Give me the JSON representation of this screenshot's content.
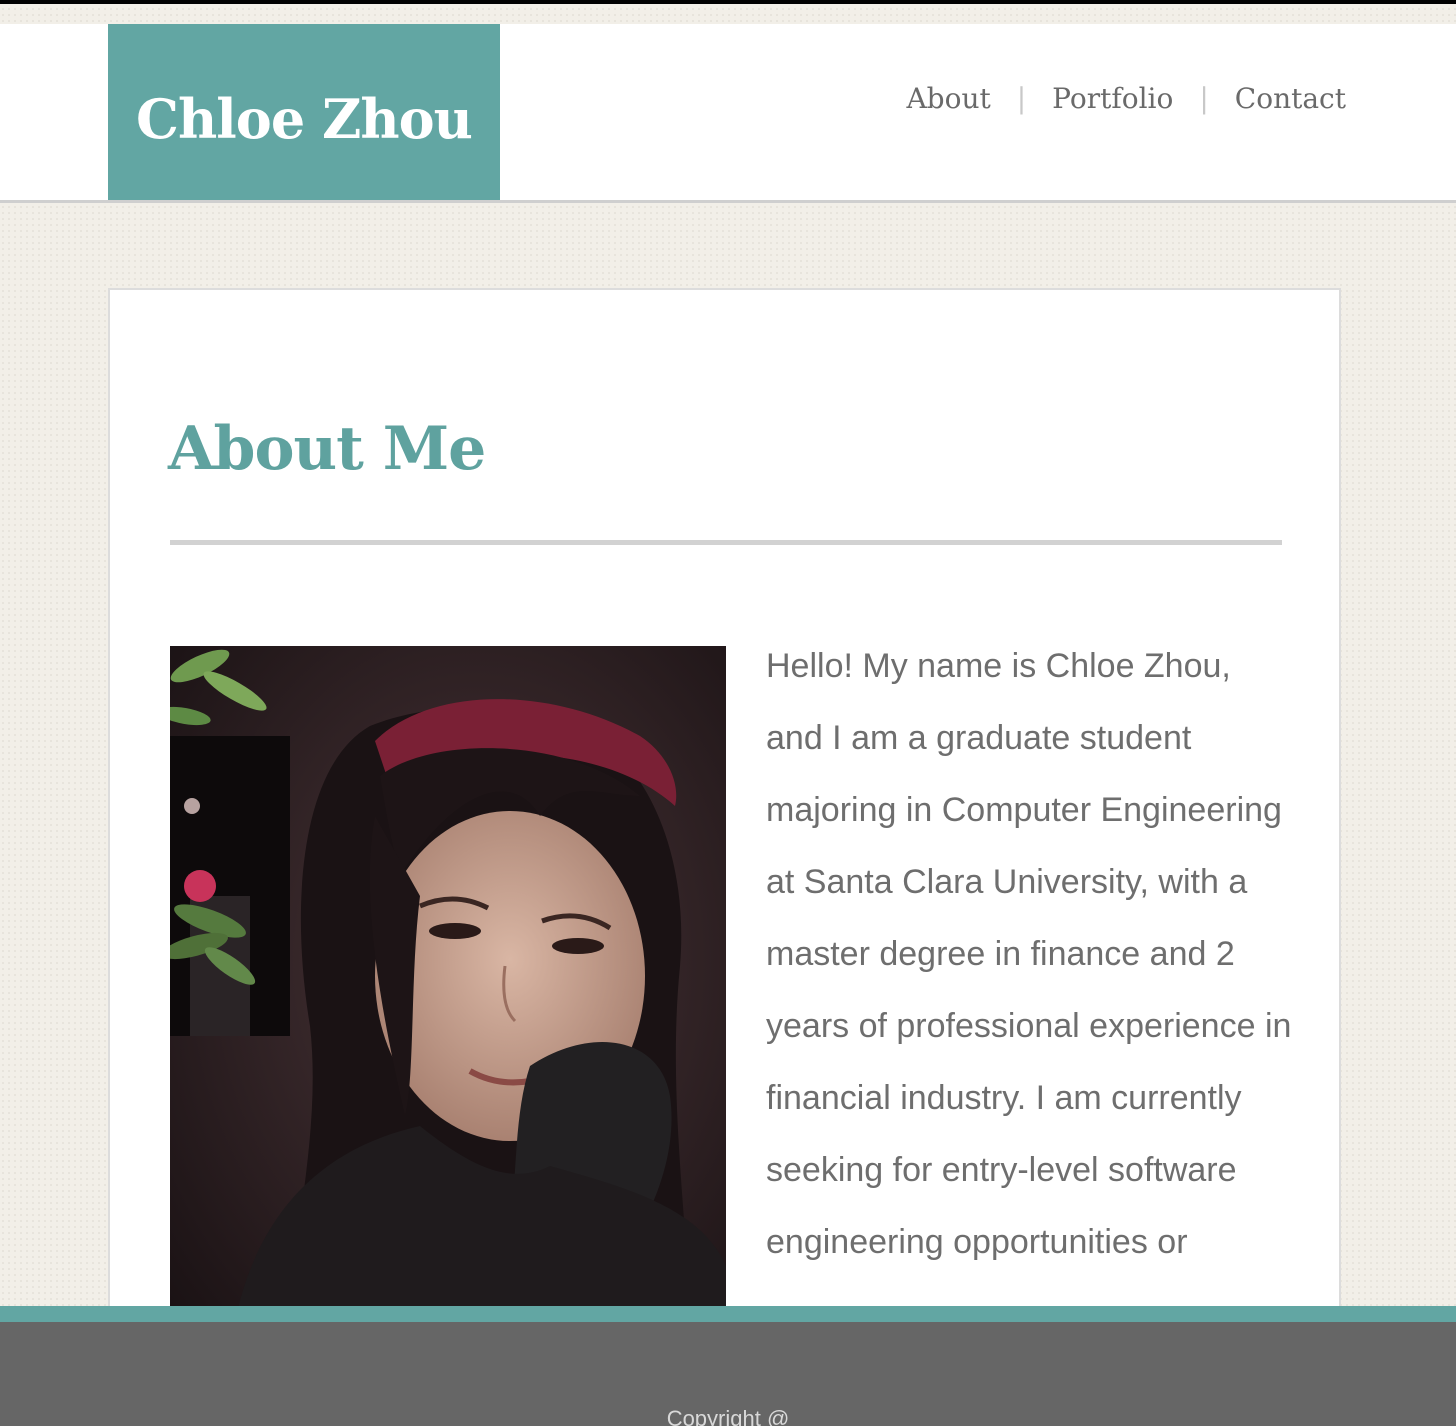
{
  "header": {
    "logo_text": "Chloe Zhou",
    "nav": [
      {
        "label": "About"
      },
      {
        "label": "Portfolio"
      },
      {
        "label": "Contact"
      }
    ],
    "nav_separator": "|"
  },
  "main": {
    "heading": "About Me",
    "bio": "Hello! My name is Chloe Zhou, and I am a graduate student majoring in Computer Engineering at Santa Clara University, with a master degree in finance and 2 years of professional experience in financial industry. I am currently seeking for entry-level software engineering opportunities or"
  },
  "footer": {
    "copyright": "Copyright @"
  },
  "colors": {
    "accent": "#62a6a3",
    "text": "#6e6e6e",
    "footer": "#666666",
    "background": "#f2efe8"
  }
}
